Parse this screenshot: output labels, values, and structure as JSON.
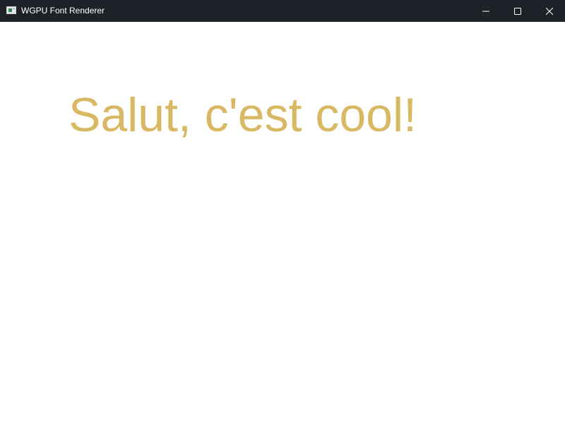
{
  "window": {
    "title": "WGPU Font Renderer",
    "app_icon": "app-window-icon",
    "controls": {
      "minimize_icon": "minimize-icon",
      "maximize_icon": "maximize-icon",
      "close_icon": "close-icon"
    }
  },
  "canvas": {
    "text": "Salut, c'est cool!",
    "text_color": "#d8b862",
    "background": "#ffffff"
  },
  "colors": {
    "titlebar_bg": "#1f2128",
    "titlebar_text": "#ffffff"
  }
}
